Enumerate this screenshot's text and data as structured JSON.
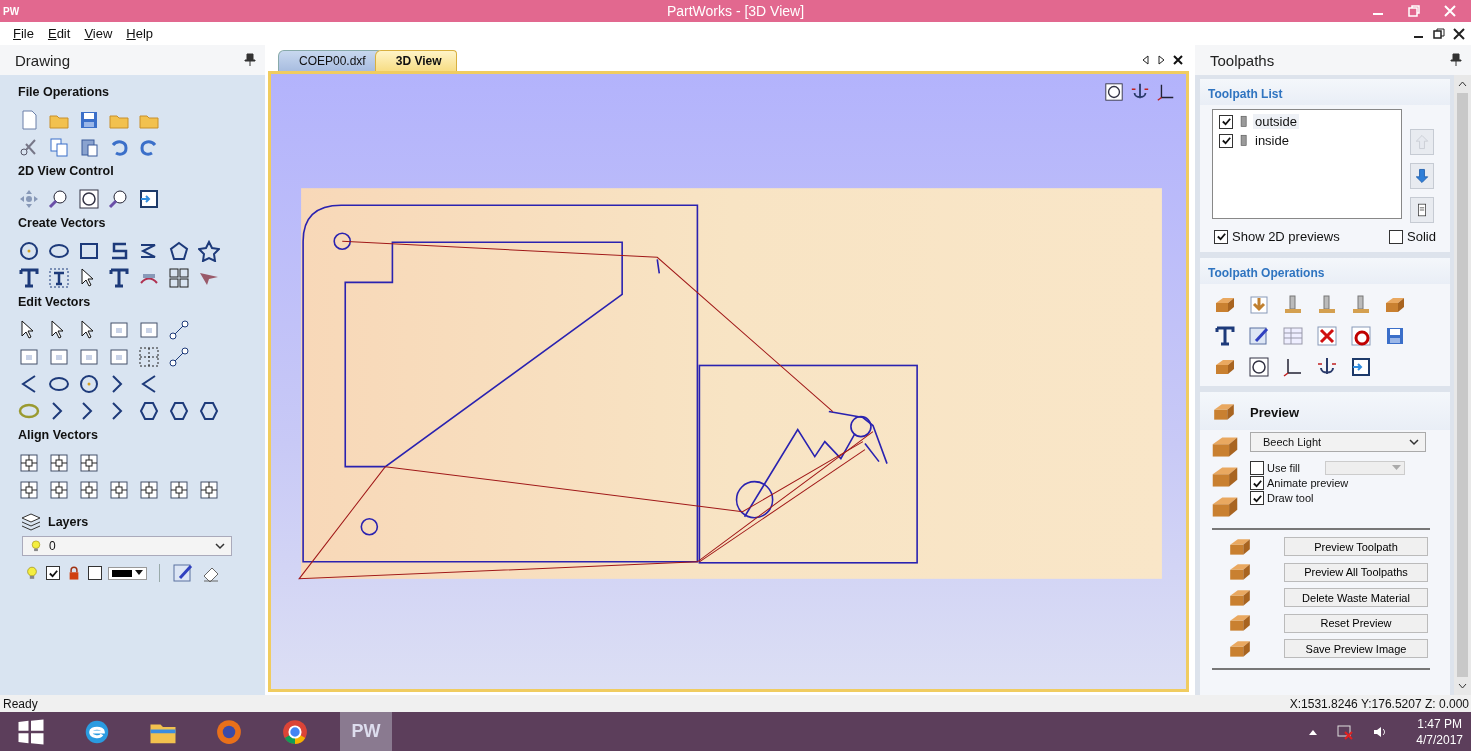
{
  "window": {
    "title": "PartWorks - [3D View]",
    "app_badge": "PW"
  },
  "menu": [
    {
      "label": "File"
    },
    {
      "label": "Edit"
    },
    {
      "label": "View"
    },
    {
      "label": "Help"
    }
  ],
  "drawing_panel": {
    "title": "Drawing",
    "sections": [
      {
        "title": "File Operations",
        "kind": "file"
      },
      {
        "title": "2D View Control",
        "kind": "view"
      },
      {
        "title": "Create Vectors",
        "kind": "create"
      },
      {
        "title": "Edit Vectors",
        "kind": "edit"
      },
      {
        "title": "Align Vectors",
        "kind": "align"
      }
    ],
    "layers": {
      "title": "Layers",
      "current": "0",
      "visible": true,
      "locked": false
    }
  },
  "document_tabs": [
    {
      "label": "COEP00.dxf",
      "selected": false
    },
    {
      "label": "3D View",
      "selected": true
    }
  ],
  "toolpaths_panel": {
    "title": "Toolpaths",
    "list_title": "Toolpath List",
    "toolpaths": [
      {
        "name": "outside",
        "checked": true,
        "selected": true
      },
      {
        "name": "inside",
        "checked": true,
        "selected": false
      }
    ],
    "options": [
      {
        "label": "Show 2D previews",
        "checked": true
      },
      {
        "label": "Solid",
        "checked": false
      }
    ],
    "operations_title": "Toolpath Operations"
  },
  "preview": {
    "title": "Preview",
    "material": "Beech Light",
    "options": [
      {
        "label": "Use fill",
        "checked": false
      },
      {
        "label": "Animate preview",
        "checked": true
      },
      {
        "label": "Draw tool",
        "checked": true
      }
    ],
    "buttons": [
      "Preview Toolpath",
      "Preview All Toolpaths",
      "Delete Waste Material",
      "Reset Preview",
      "Save Preview Image"
    ]
  },
  "status_bar": {
    "text": "Ready",
    "coordinates": "X:1531.8246 Y:176.5207 Z: 0.000"
  },
  "taskbar": {
    "apps": [
      {
        "kind": "start",
        "selected": false
      },
      {
        "kind": "browser-e",
        "selected": false
      },
      {
        "kind": "folder",
        "selected": false
      },
      {
        "kind": "firefox",
        "selected": false
      },
      {
        "kind": "chrome",
        "selected": false
      },
      {
        "kind": "pw",
        "label": "PW",
        "selected": true
      }
    ],
    "clock": {
      "time": "1:47 PM",
      "date": "4/7/2017"
    }
  }
}
